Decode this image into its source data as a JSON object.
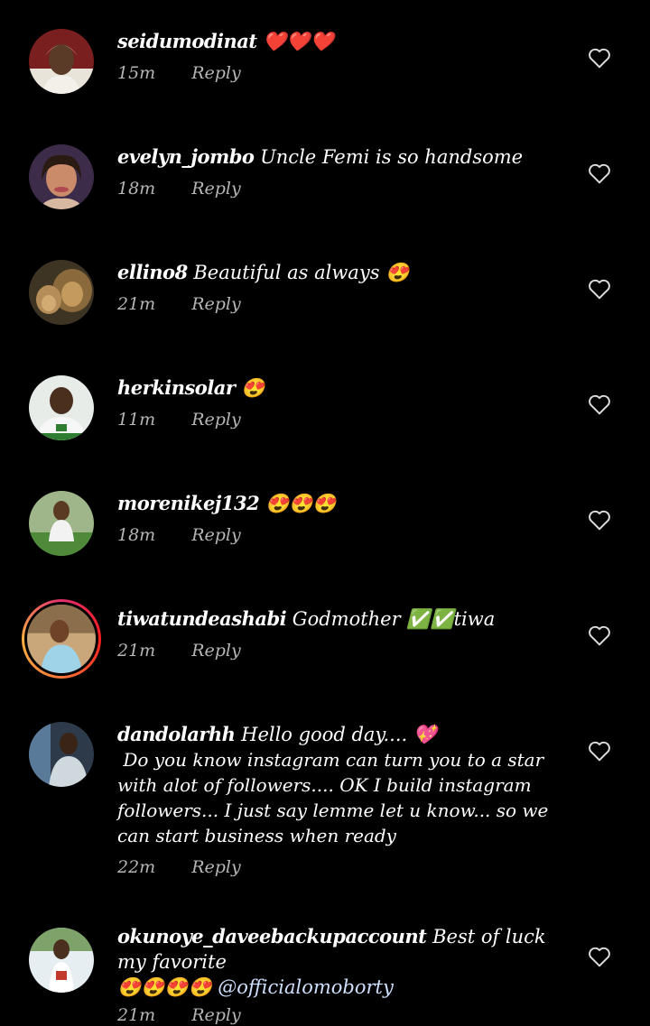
{
  "colors": {
    "background": "#000000",
    "text": "#ffffff",
    "meta": "#b5b5b5",
    "heart_outline": "#dddddd",
    "mention": "#cfe0ff"
  },
  "comments": [
    {
      "username": "seidumodinat",
      "text": "❤️❤️❤️",
      "time": "15m",
      "reply": "Reply",
      "avatar_icon": "avatar-woman-headwrap"
    },
    {
      "username": "evelyn_jombo",
      "text": "Uncle Femi is so handsome",
      "time": "18m",
      "reply": "Reply",
      "avatar_icon": "avatar-woman-portrait"
    },
    {
      "username": "ellino8",
      "text": "Beautiful as always 😍",
      "time": "21m",
      "reply": "Reply",
      "avatar_icon": "avatar-lions"
    },
    {
      "username": "herkinsolar",
      "text": "😍",
      "time": "11m",
      "reply": "Reply",
      "avatar_icon": "avatar-man-white-shirt"
    },
    {
      "username": "morenikej132",
      "text": "😍😍😍",
      "time": "18m",
      "reply": "Reply",
      "avatar_icon": "avatar-woman-field"
    },
    {
      "username": "tiwatundeashabi",
      "text": "Godmother ✅✅tiwa",
      "time": "21m",
      "reply": "Reply",
      "avatar_icon": "avatar-woman-story"
    },
    {
      "username": "dandolarhh",
      "text": "Hello good day.... 💖",
      "text_extra": " Do you know instagram can turn you to a star with alot of followers.... OK I build instagram followers... I just say lemme let u know... so we can start business when ready",
      "time": "22m",
      "reply": "Reply",
      "avatar_icon": "avatar-man-dark"
    },
    {
      "username": "okunoye_daveebackupaccount",
      "text": "Best of luck my favorite",
      "text_extra": "😍😍😍😍",
      "mention": "@officialomoborty",
      "time": "21m",
      "reply": "Reply",
      "avatar_icon": "avatar-man-outdoor"
    }
  ]
}
